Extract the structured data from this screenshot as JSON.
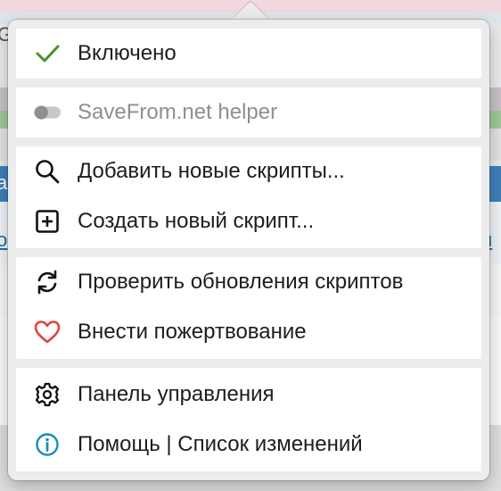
{
  "colors": {
    "check": "#4a8f2b",
    "heart": "#e0453c",
    "info": "#1a8db5",
    "toggle_off": "#8e8e93"
  },
  "background": {
    "letters": [
      "G",
      "a",
      "o",
      "u"
    ]
  },
  "menu": {
    "enabled": {
      "label": "Включено",
      "icon": "checkmark-icon"
    },
    "script": {
      "label": "SaveFrom.net helper",
      "icon": "toggle-off-icon",
      "enabled": false
    },
    "add_scripts": {
      "label": "Добавить новые скрипты...",
      "icon": "search-icon"
    },
    "create_script": {
      "label": "Создать новый скрипт...",
      "icon": "plus-square-icon"
    },
    "check_updates": {
      "label": "Проверить обновления скриптов",
      "icon": "refresh-icon"
    },
    "donate": {
      "label": "Внести пожертвование",
      "icon": "heart-icon"
    },
    "dashboard": {
      "label": "Панель управления",
      "icon": "gear-icon"
    },
    "help": {
      "label": "Помощь | Список изменений",
      "icon": "info-icon"
    }
  }
}
